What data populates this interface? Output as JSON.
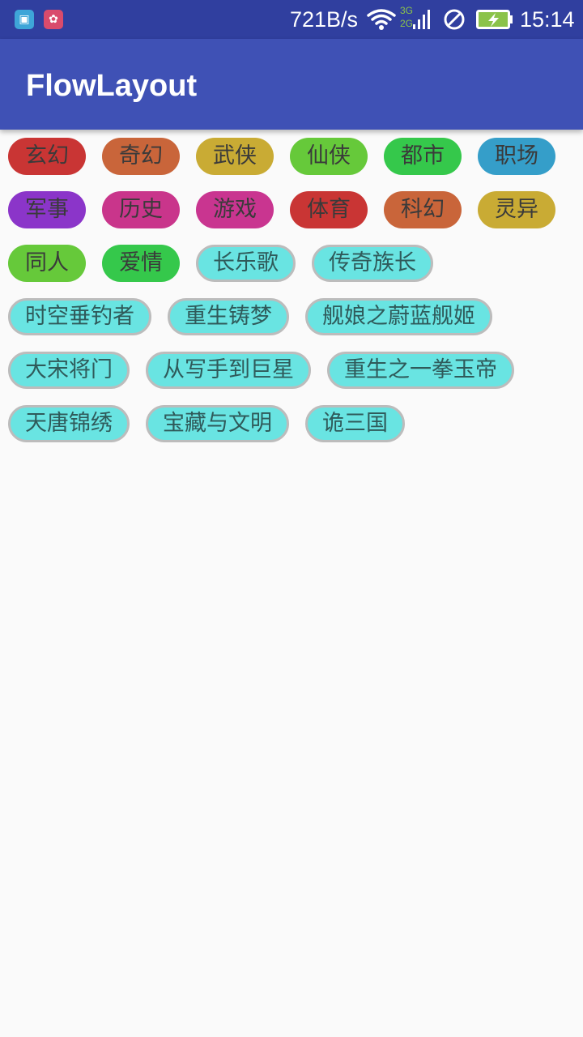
{
  "status_bar": {
    "network_speed": "721B/s",
    "network_3g": "3G",
    "network_2g": "2G",
    "time": "15:14",
    "icons": [
      "android-icon",
      "huawei-icon",
      "wifi-icon",
      "signal-icon",
      "do-not-disturb-icon",
      "battery-charging-icon"
    ]
  },
  "app_bar": {
    "title": "FlowLayout"
  },
  "categories": [
    {
      "label": "玄幻",
      "color": "#c93534"
    },
    {
      "label": "奇幻",
      "color": "#c9653a"
    },
    {
      "label": "武侠",
      "color": "#c9ab34"
    },
    {
      "label": "仙侠",
      "color": "#66c93a"
    },
    {
      "label": "都市",
      "color": "#35c84b"
    },
    {
      "label": "职场",
      "color": "#359ec9"
    },
    {
      "label": "军事",
      "color": "#8b35c9"
    },
    {
      "label": "历史",
      "color": "#c9358b"
    },
    {
      "label": "游戏",
      "color": "#c93590"
    },
    {
      "label": "体育",
      "color": "#c93534"
    },
    {
      "label": "科幻",
      "color": "#c9653a"
    },
    {
      "label": "灵异",
      "color": "#c9ab34"
    },
    {
      "label": "同人",
      "color": "#66c93a"
    },
    {
      "label": "爱情",
      "color": "#35c84b"
    }
  ],
  "books": [
    "长乐歌",
    "传奇族长",
    "时空垂钓者",
    "重生铸梦",
    "舰娘之蔚蓝舰姬",
    "大宋将门",
    "从写手到巨星",
    "重生之一拳玉帝",
    "天唐锦绣",
    "宝藏与文明",
    "诡三国"
  ]
}
